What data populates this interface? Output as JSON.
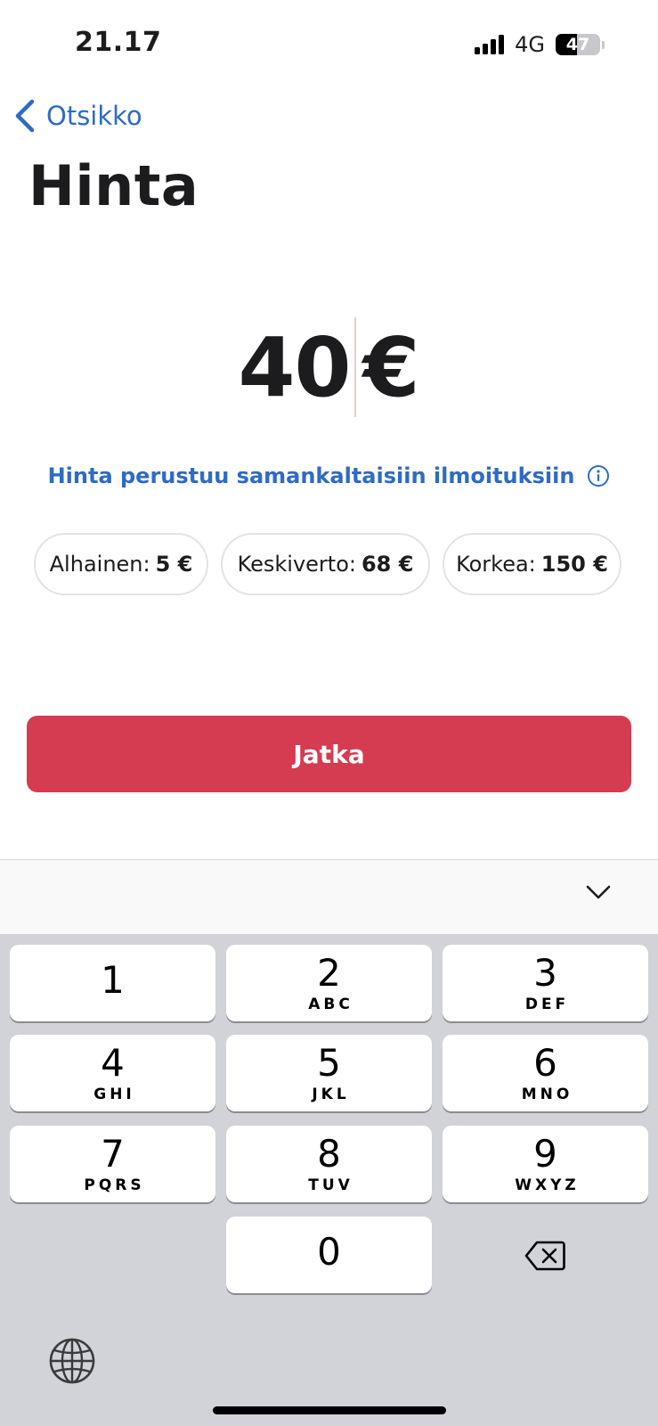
{
  "status_bar": {
    "time": "21.17",
    "network": "4G",
    "battery": "47",
    "battery_level": 0.47
  },
  "nav": {
    "back_label": "Otsikko",
    "back_icon": "chevron-left-icon"
  },
  "page": {
    "title": "Hinta"
  },
  "price": {
    "value": "40",
    "currency": "€"
  },
  "price_hint": {
    "text": "Hinta perustuu samankaltaisiin ilmoituksiin",
    "icon": "info-icon"
  },
  "price_chips": [
    {
      "label": "Alhainen:",
      "value": "5 €"
    },
    {
      "label": "Keskiverto:",
      "value": "68 €"
    },
    {
      "label": "Korkea:",
      "value": "150 €"
    }
  ],
  "continue_button": {
    "label": "Jatka"
  },
  "keyboard_accessory": {
    "dismiss_icon": "chevron-down-icon"
  },
  "keypad": {
    "keys": [
      {
        "digit": "1",
        "letters": ""
      },
      {
        "digit": "2",
        "letters": "ABC"
      },
      {
        "digit": "3",
        "letters": "DEF"
      },
      {
        "digit": "4",
        "letters": "GHI"
      },
      {
        "digit": "5",
        "letters": "JKL"
      },
      {
        "digit": "6",
        "letters": "MNO"
      },
      {
        "digit": "7",
        "letters": "PQRS"
      },
      {
        "digit": "8",
        "letters": "TUV"
      },
      {
        "digit": "9",
        "letters": "WXYZ"
      },
      {
        "digit": "0",
        "letters": ""
      }
    ],
    "backspace_icon": "backspace-icon",
    "globe_icon": "globe-icon"
  },
  "colors": {
    "accent_blue": "#2e6bc6",
    "button_red": "#d53c51",
    "keyboard_bg": "#d1d3d9"
  }
}
